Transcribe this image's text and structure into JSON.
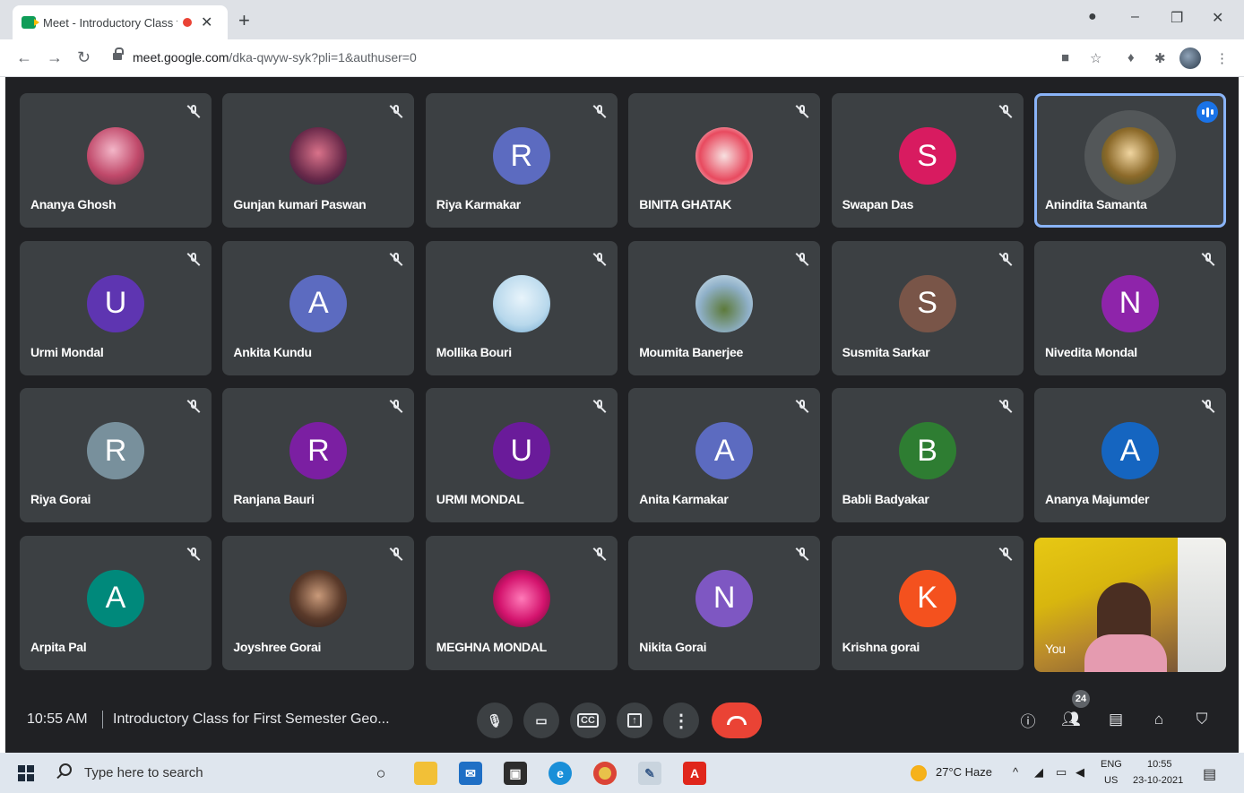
{
  "browser": {
    "tab_title": "Meet - Introductory Class fo",
    "tab_close": "✕",
    "new_tab": "+",
    "url_domain": "meet.google.com",
    "url_path": "/dka-qwyw-syk?pli=1&authuser=0",
    "window_controls": [
      "–",
      "❐",
      "✕"
    ]
  },
  "meeting": {
    "time": "10:55 AM",
    "title": "Introductory Class for First Semester Geo...",
    "participant_count": "24",
    "participants": [
      {
        "name": "Ananya Ghosh",
        "initial": "",
        "color": "",
        "photo": true
      },
      {
        "name": "Gunjan kumari Paswan",
        "initial": "",
        "color": "",
        "photo": true
      },
      {
        "name": "Riya Karmakar",
        "initial": "R",
        "color": "#5c6bc0",
        "photo": false
      },
      {
        "name": "BINITA GHATAK",
        "initial": "",
        "color": "",
        "photo": true
      },
      {
        "name": "Swapan Das",
        "initial": "S",
        "color": "#d81b60",
        "photo": false
      },
      {
        "name": "Anindita Samanta",
        "initial": "",
        "color": "",
        "photo": true,
        "speaking": true
      },
      {
        "name": "Urmi Mondal",
        "initial": "U",
        "color": "#5e35b1",
        "photo": false
      },
      {
        "name": "Ankita Kundu",
        "initial": "A",
        "color": "#5c6bc0",
        "photo": false
      },
      {
        "name": "Mollika Bouri",
        "initial": "",
        "color": "",
        "photo": true
      },
      {
        "name": "Moumita Banerjee",
        "initial": "",
        "color": "",
        "photo": true
      },
      {
        "name": "Susmita Sarkar",
        "initial": "S",
        "color": "#795548",
        "photo": false
      },
      {
        "name": "Nivedita Mondal",
        "initial": "N",
        "color": "#8e24aa",
        "photo": false
      },
      {
        "name": "Riya Gorai",
        "initial": "R",
        "color": "#78909c",
        "photo": false
      },
      {
        "name": "Ranjana Bauri",
        "initial": "R",
        "color": "#7b1fa2",
        "photo": false
      },
      {
        "name": "URMI MONDAL",
        "initial": "U",
        "color": "#6a1b9a",
        "photo": false
      },
      {
        "name": "Anita Karmakar",
        "initial": "A",
        "color": "#5c6bc0",
        "photo": false
      },
      {
        "name": "Babli Badyakar",
        "initial": "B",
        "color": "#2e7d32",
        "photo": false
      },
      {
        "name": "Ananya Majumder",
        "initial": "A",
        "color": "#1565c0",
        "photo": false
      },
      {
        "name": "Arpita Pal",
        "initial": "A",
        "color": "#00897b",
        "photo": false
      },
      {
        "name": "Joyshree Gorai",
        "initial": "",
        "color": "",
        "photo": true
      },
      {
        "name": "MEGHNA MONDAL",
        "initial": "",
        "color": "",
        "photo": true
      },
      {
        "name": "Nikita Gorai",
        "initial": "N",
        "color": "#7e57c2",
        "photo": false
      },
      {
        "name": "Krishna gorai",
        "initial": "K",
        "color": "#f4511e",
        "photo": false
      }
    ],
    "self_label": "You",
    "controls": {
      "captions_label": "CC"
    }
  },
  "taskbar": {
    "search_placeholder": "Type here to search",
    "weather": "27°C  Haze",
    "lang_top": "ENG",
    "lang_bottom": "US",
    "time": "10:55",
    "date": "23-10-2021"
  }
}
